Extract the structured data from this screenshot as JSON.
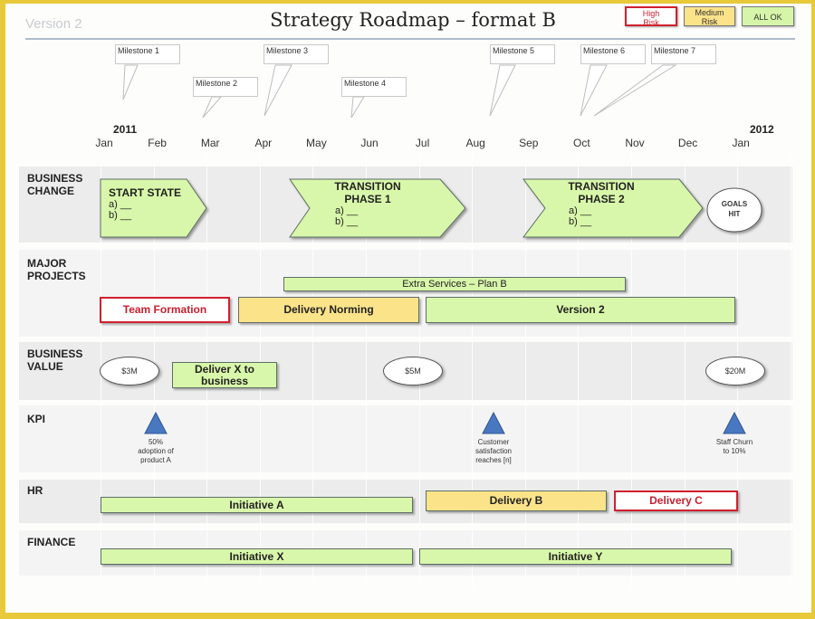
{
  "header": {
    "version_label": "Version 2",
    "title": "Strategy Roadmap – format B"
  },
  "legend": [
    {
      "label_line1": "High",
      "label_line2": "Risk",
      "status": "high-risk",
      "color": "#d0202f"
    },
    {
      "label_line1": "Medium",
      "label_line2": "Risk",
      "status": "medium-risk",
      "color": "#fbe38a"
    },
    {
      "label_line1": "ALL OK",
      "label_line2": "",
      "status": "ok",
      "color": "#d6f5a8"
    }
  ],
  "milestones": [
    {
      "label": "Milestone 1",
      "month": "Jan"
    },
    {
      "label": "Milestone 2",
      "month": "Mar"
    },
    {
      "label": "Milestone 3",
      "month": "Apr"
    },
    {
      "label": "Milestone 4",
      "month": "May"
    },
    {
      "label": "Milestone 5",
      "month": "Aug"
    },
    {
      "label": "Milestone 6",
      "month": "Oct"
    },
    {
      "label": "Milestone 7",
      "month": "Oct"
    }
  ],
  "timeline": {
    "start_year": "2011",
    "end_year": "2012",
    "months": [
      "Jan",
      "Feb",
      "Mar",
      "Apr",
      "May",
      "Jun",
      "Jul",
      "Aug",
      "Sep",
      "Oct",
      "Nov",
      "Dec",
      "Jan"
    ]
  },
  "rows": {
    "business_change": {
      "label_line1": "BUSINESS",
      "label_line2": "CHANGE",
      "start_state": {
        "title": "START STATE",
        "item_a": "a)  __",
        "item_b": "b)  __"
      },
      "phase1": {
        "title_line1": "TRANSITION",
        "title_line2": "PHASE 1",
        "item_a": "a) __",
        "item_b": "b) __"
      },
      "phase2": {
        "title_line1": "TRANSITION",
        "title_line2": "PHASE 2",
        "item_a": "a) __",
        "item_b": "b) __"
      },
      "goals": {
        "line1": "GOALS",
        "line2": "HIT"
      }
    },
    "major_projects": {
      "label_line1": "MAJOR",
      "label_line2": "PROJECTS",
      "bars": [
        {
          "label": "Extra Services – Plan B",
          "status": "ok"
        },
        {
          "label": "Team Formation",
          "status": "high-risk"
        },
        {
          "label": "Delivery Norming",
          "status": "medium-risk"
        },
        {
          "label": "Version 2",
          "status": "ok"
        }
      ]
    },
    "business_value": {
      "label_line1": "BUSINESS",
      "label_line2": "VALUE",
      "values": [
        "$3M",
        "$5M",
        "$20M"
      ],
      "deliver_line1": "Deliver X to",
      "deliver_line2": "business"
    },
    "kpi": {
      "label": "KPI",
      "items": [
        {
          "line1": "50%",
          "line2": "adoption of",
          "line3": "product A"
        },
        {
          "line1": "Customer",
          "line2": "satisfaction",
          "line3": "reaches [n]"
        },
        {
          "line1": "Staff Churn",
          "line2": "to 10%",
          "line3": ""
        }
      ]
    },
    "hr": {
      "label": "HR",
      "bars": [
        {
          "label": "Initiative A",
          "status": "ok"
        },
        {
          "label": "Delivery B",
          "status": "medium-risk"
        },
        {
          "label": "Delivery C",
          "status": "high-risk"
        }
      ]
    },
    "finance": {
      "label": "FINANCE",
      "bars": [
        {
          "label": "Initiative X",
          "status": "ok"
        },
        {
          "label": "Initiative Y",
          "status": "ok"
        }
      ]
    }
  }
}
